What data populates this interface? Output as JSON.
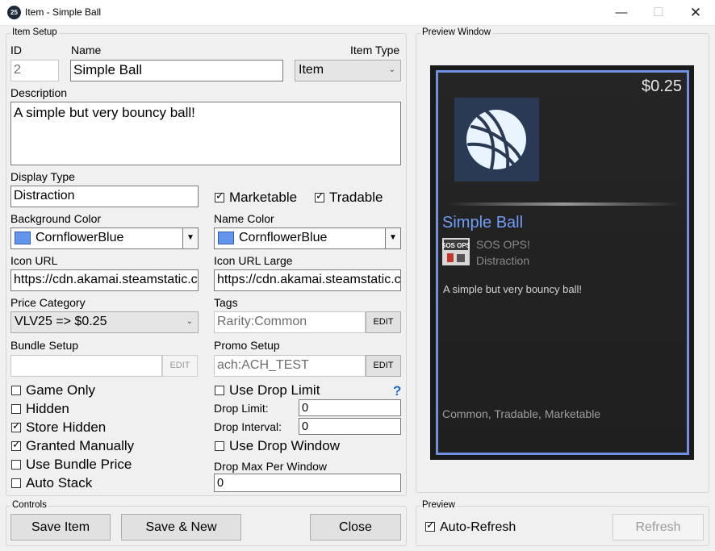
{
  "window": {
    "title": "Item - Simple Ball",
    "app_icon_text": "25"
  },
  "item_setup": {
    "group_label": "Item Setup",
    "id": {
      "label": "ID",
      "value": "2"
    },
    "name": {
      "label": "Name",
      "value": "Simple Ball"
    },
    "item_type": {
      "label": "Item Type",
      "value": "Item"
    },
    "description": {
      "label": "Description",
      "value": "A simple but very bouncy ball!"
    },
    "display_type": {
      "label": "Display Type",
      "value": "Distraction"
    },
    "marketable": {
      "label": "Marketable",
      "checked": true
    },
    "tradable": {
      "label": "Tradable",
      "checked": true
    },
    "background_color": {
      "label": "Background Color",
      "value": "CornflowerBlue",
      "swatch": "#6495ed"
    },
    "name_color": {
      "label": "Name Color",
      "value": "CornflowerBlue",
      "swatch": "#6495ed"
    },
    "icon_url": {
      "label": "Icon URL",
      "value": "https://cdn.akamai.steamstatic.c"
    },
    "icon_url_large": {
      "label": "Icon URL Large",
      "value": "https://cdn.akamai.steamstatic.c"
    },
    "price_category": {
      "label": "Price Category",
      "value": "VLV25 => $0.25"
    },
    "tags": {
      "label": "Tags",
      "value": "Rarity:Common",
      "edit": "EDIT"
    },
    "bundle_setup": {
      "label": "Bundle Setup",
      "value": "",
      "edit": "EDIT"
    },
    "promo_setup": {
      "label": "Promo Setup",
      "value": "ach:ACH_TEST",
      "edit": "EDIT"
    },
    "checkboxes": [
      {
        "label": "Game Only",
        "checked": false
      },
      {
        "label": "Hidden",
        "checked": false
      },
      {
        "label": "Store Hidden",
        "checked": true
      },
      {
        "label": "Granted Manually",
        "checked": true
      },
      {
        "label": "Use Bundle Price",
        "checked": false
      },
      {
        "label": "Auto Stack",
        "checked": false
      }
    ],
    "use_drop_limit": {
      "label": "Use Drop Limit",
      "checked": false,
      "help": "?"
    },
    "drop_limit": {
      "label": "Drop Limit:",
      "value": "0"
    },
    "drop_interval": {
      "label": "Drop Interval:",
      "value": "0"
    },
    "use_drop_window": {
      "label": "Use Drop Window",
      "checked": false
    },
    "drop_max_per_window": {
      "label": "Drop Max Per Window",
      "value": "0"
    }
  },
  "controls": {
    "group_label": "Controls",
    "save_item": "Save Item",
    "save_new": "Save & New",
    "close": "Close"
  },
  "preview": {
    "group_label": "Preview Window",
    "price": "$0.25",
    "item_name": "Simple Ball",
    "game_name": "SOS OPS!",
    "game_icon_text": "SOS OPS",
    "display_type": "Distraction",
    "description": "A simple but very bouncy ball!",
    "tags": "Common, Tradable, Marketable",
    "colors": {
      "border": "#6f91e0",
      "name": "#6f9ef6",
      "icon_bg": "#2a3a55"
    }
  },
  "preview_controls": {
    "group_label": "Preview",
    "auto_refresh": {
      "label": "Auto-Refresh",
      "checked": true
    },
    "refresh": "Refresh"
  }
}
